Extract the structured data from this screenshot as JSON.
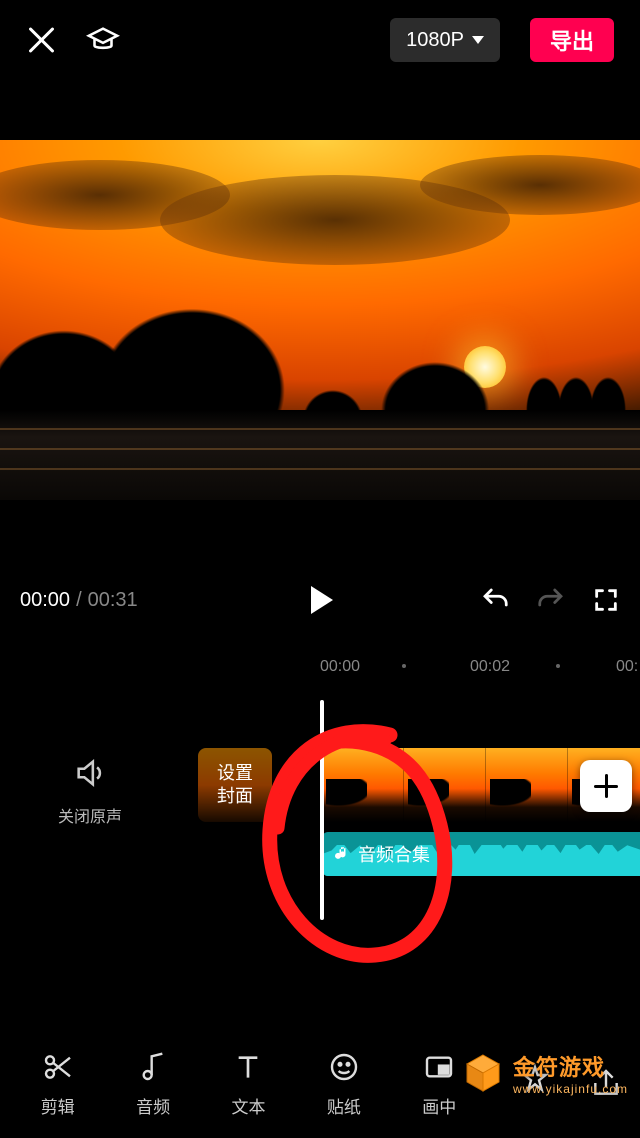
{
  "topbar": {
    "resolution_label": "1080P",
    "export_label": "导出"
  },
  "playback": {
    "current_time": "00:00",
    "duration": "00:31"
  },
  "ruler": {
    "t0": "00:00",
    "t1": "00:02",
    "t2": "00:"
  },
  "timeline": {
    "mute_label": "关闭原声",
    "cover_label": "设置\n封面",
    "audio_label": "音频合集"
  },
  "toolbar": {
    "items": [
      {
        "icon": "scissors",
        "label": "剪辑"
      },
      {
        "icon": "music-note",
        "label": "音频"
      },
      {
        "icon": "text",
        "label": "文本"
      },
      {
        "icon": "sticker",
        "label": "贴纸"
      },
      {
        "icon": "pip",
        "label": "画中"
      }
    ]
  },
  "watermark": {
    "name": "金符游戏",
    "url": "www.yikajinfu.com"
  }
}
